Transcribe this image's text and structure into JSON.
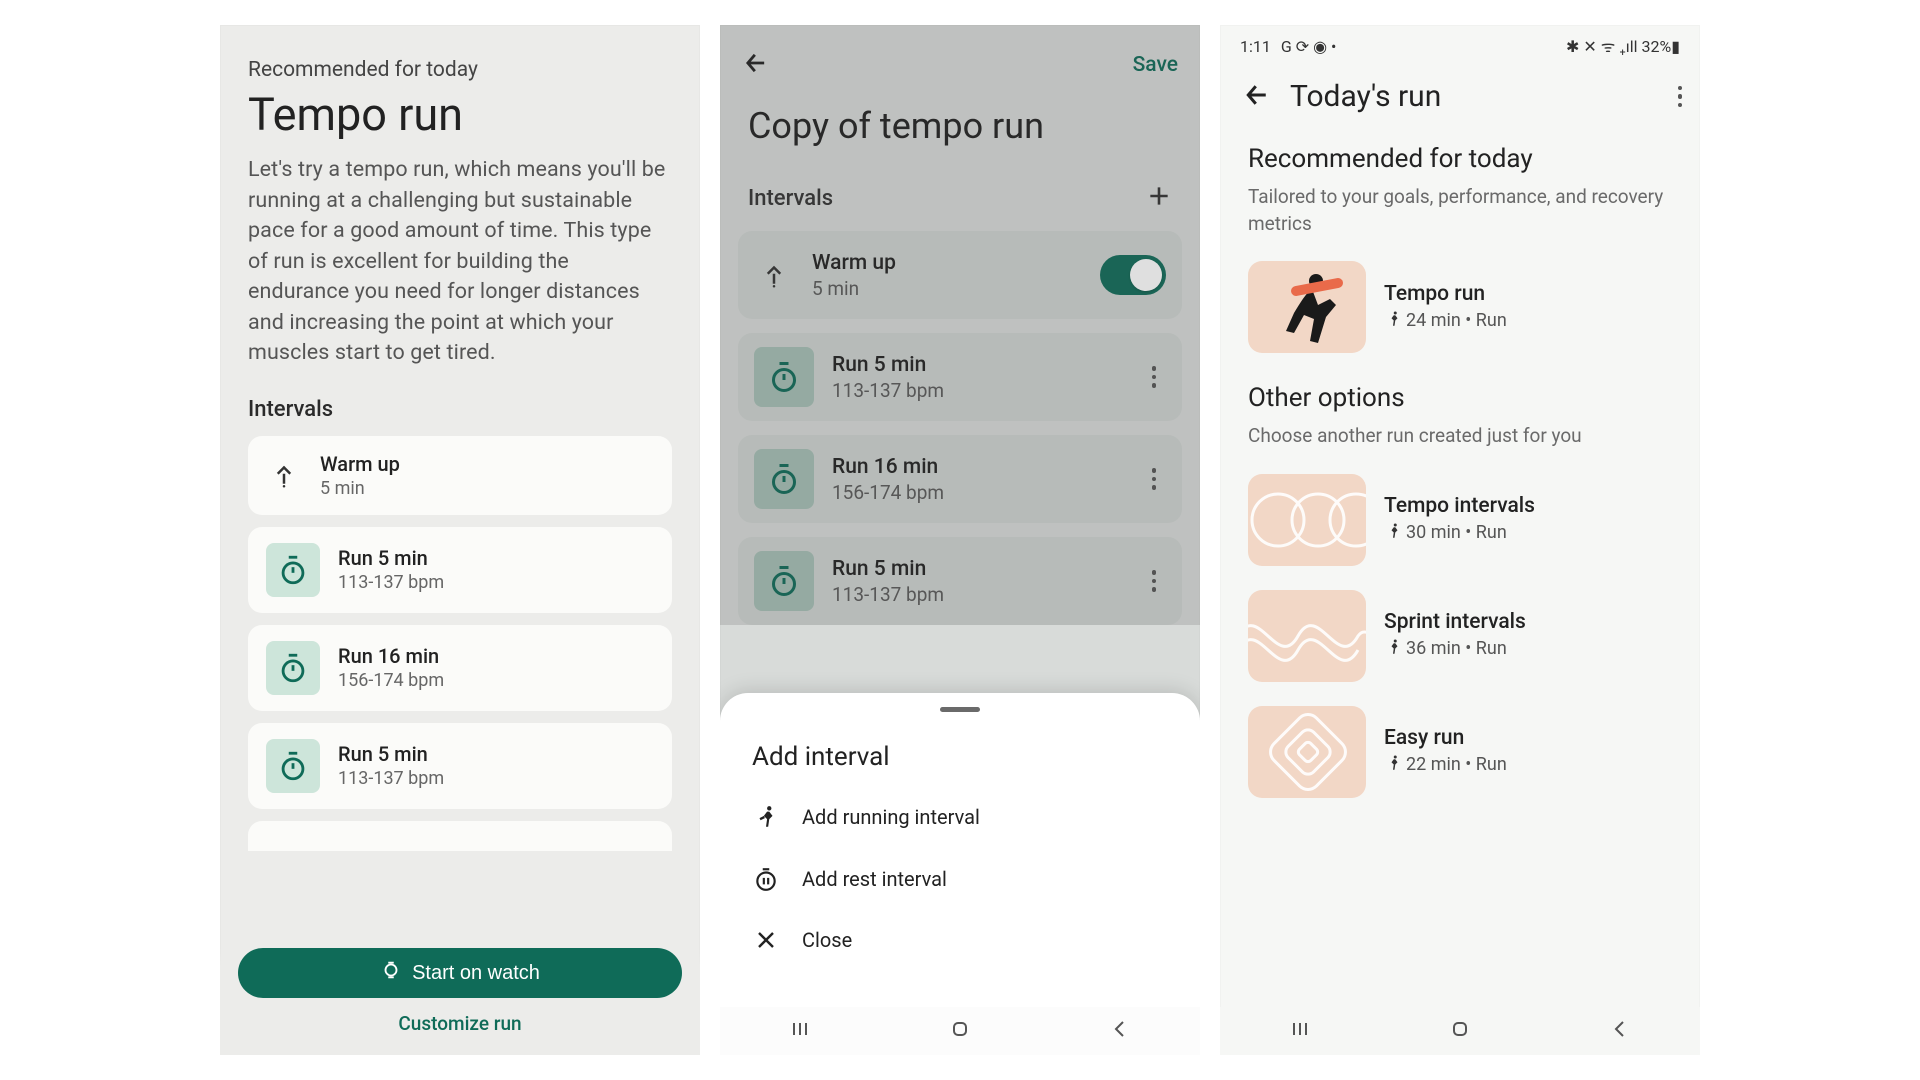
{
  "screen1": {
    "recommended_label": "Recommended for today",
    "title": "Tempo run",
    "description": "Let's try a tempo run, which means you'll be running at a challenging but sustainable pace for a good amount of time. This type of run is excellent for building the endurance you need for longer distances and increasing the point at which your muscles start to get tired.",
    "intervals_label": "Intervals",
    "intervals": [
      {
        "title": "Warm up",
        "sub": "5 min",
        "type": "warmup"
      },
      {
        "title": "Run 5 min",
        "sub": "113-137 bpm",
        "type": "run"
      },
      {
        "title": "Run 16 min",
        "sub": "156-174 bpm",
        "type": "run"
      },
      {
        "title": "Run 5 min",
        "sub": "113-137 bpm",
        "type": "run"
      }
    ],
    "start_button": "Start on watch",
    "customize_link": "Customize run"
  },
  "screen2": {
    "save_label": "Save",
    "title": "Copy of tempo run",
    "intervals_label": "Intervals",
    "intervals": [
      {
        "title": "Warm up",
        "sub": "5 min",
        "type": "warmup",
        "toggle": true
      },
      {
        "title": "Run 5 min",
        "sub": "113-137 bpm",
        "type": "run"
      },
      {
        "title": "Run 16 min",
        "sub": "156-174 bpm",
        "type": "run"
      },
      {
        "title": "Run 5 min",
        "sub": "113-137 bpm",
        "type": "run"
      }
    ],
    "sheet": {
      "title": "Add interval",
      "items": [
        {
          "label": "Add running interval",
          "icon": "run"
        },
        {
          "label": "Add rest interval",
          "icon": "pause"
        },
        {
          "label": "Close",
          "icon": "close"
        }
      ]
    }
  },
  "screen3": {
    "status": {
      "time": "1:11",
      "indicators": "G ⟳ ◉  •",
      "right": "✱ ✕ ᯤ ₊ıll 32%▮"
    },
    "title": "Today's run",
    "section1": {
      "heading": "Recommended for today",
      "sub": "Tailored to your goals, performance, and recovery metrics",
      "run": {
        "title": "Tempo run",
        "meta": "24 min  •  Run",
        "tile": "runner"
      }
    },
    "section2": {
      "heading": "Other options",
      "sub": "Choose another run created just for you",
      "runs": [
        {
          "title": "Tempo intervals",
          "meta": "30 min  •  Run",
          "tile": "loops"
        },
        {
          "title": "Sprint intervals",
          "meta": "36 min  •  Run",
          "tile": "waves"
        },
        {
          "title": "Easy run",
          "meta": "22 min  •  Run",
          "tile": "diamond"
        }
      ]
    }
  },
  "colors": {
    "brand": "#0f6b58",
    "tile": "#f2d7c6",
    "mint": "#cde5da"
  }
}
